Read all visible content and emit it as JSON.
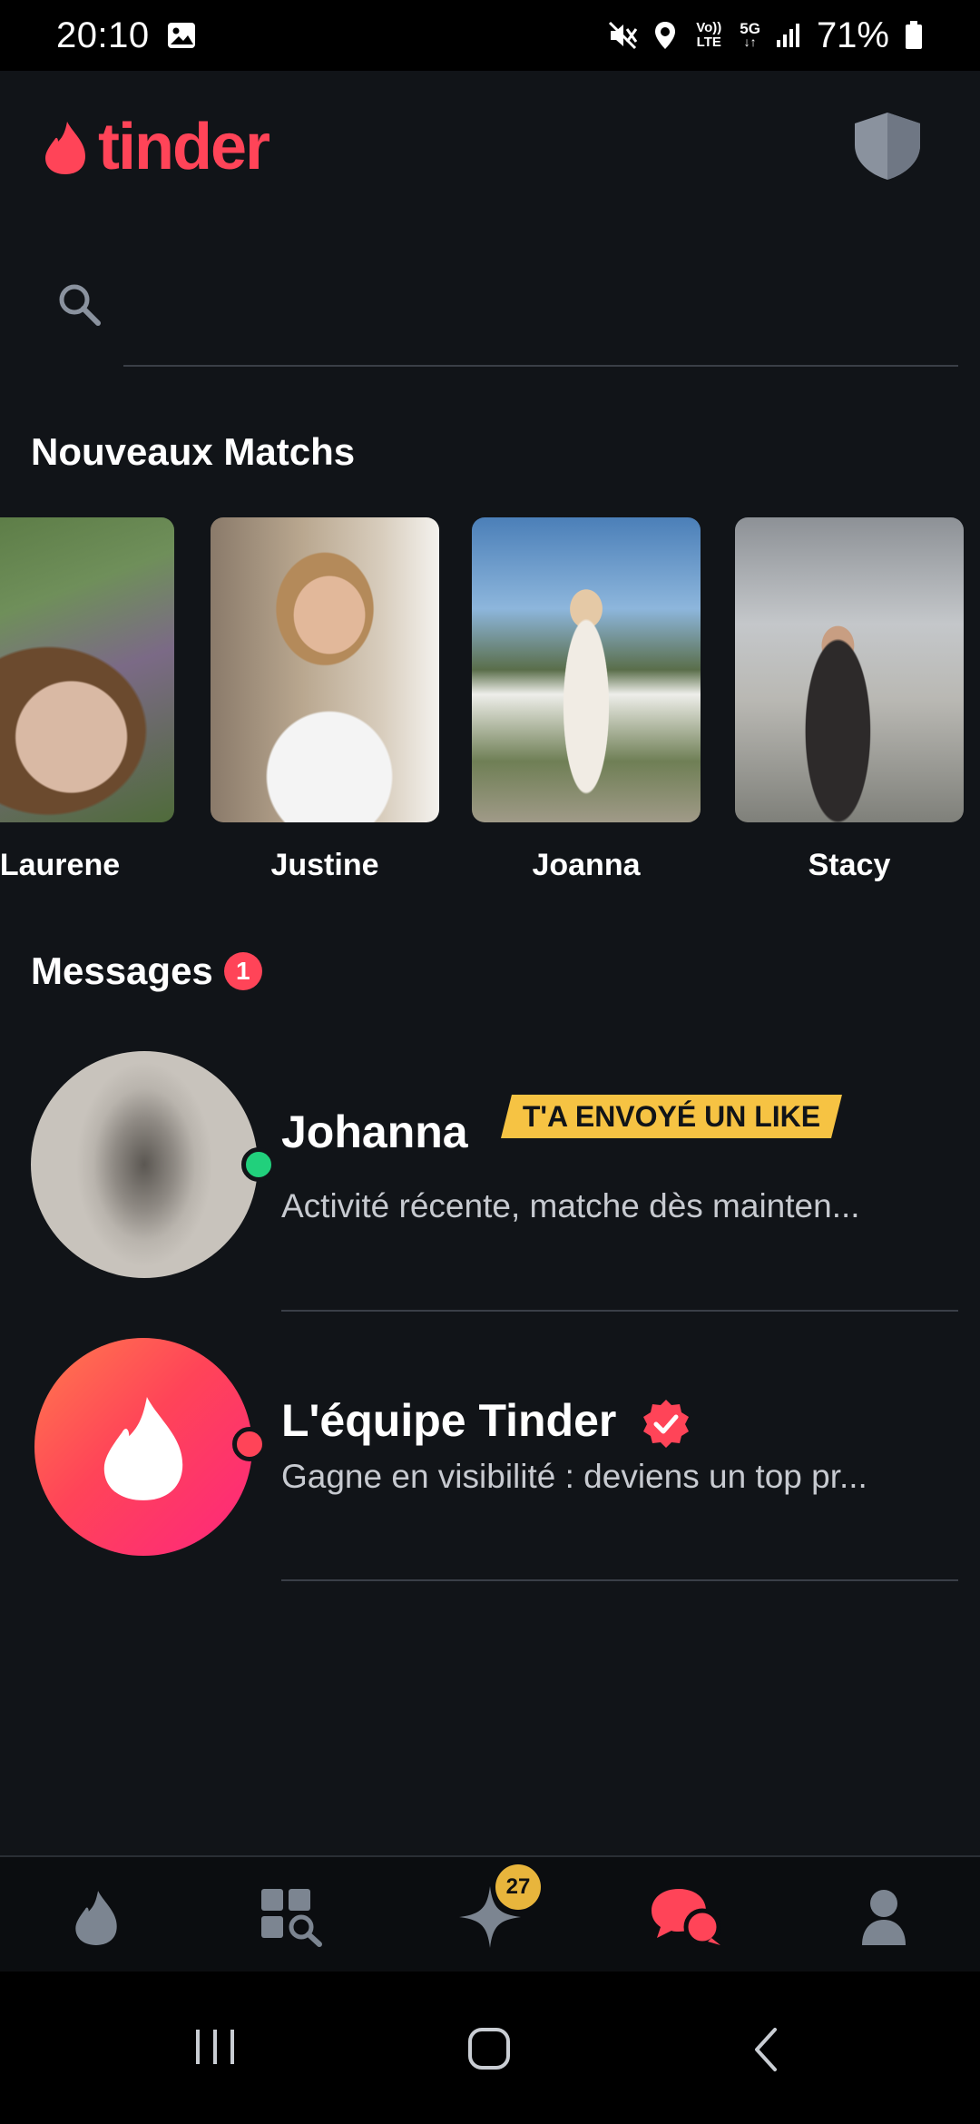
{
  "status_bar": {
    "time": "20:10",
    "battery": "71%",
    "volte": "Vo)) LTE",
    "network": "5G"
  },
  "header": {
    "logo_text": "tinder"
  },
  "search": {
    "placeholder": ""
  },
  "new_matches": {
    "title": "Nouveaux Matchs",
    "items": [
      {
        "name": "Laurene"
      },
      {
        "name": "Justine"
      },
      {
        "name": "Joanna"
      },
      {
        "name": "Stacy"
      }
    ]
  },
  "messages": {
    "title": "Messages",
    "unread_count": "1",
    "items": [
      {
        "name": "Johanna",
        "tag": "T'A ENVOYÉ UN LIKE",
        "preview": "Activité récente, matche dès mainten...",
        "status_color": "#21d07c"
      },
      {
        "name": "L'équipe Tinder",
        "preview": "Gagne en visibilité : deviens un top pr...",
        "status_color": "#ff4458"
      }
    ]
  },
  "bottom_nav": {
    "likes_count": "27",
    "items": [
      "flame-icon",
      "explore-icon",
      "sparkle-icon",
      "chat-icon",
      "profile-icon"
    ]
  },
  "colors": {
    "brand": "#ff4458",
    "background": "#111418",
    "like_tag": "#f6c343"
  }
}
